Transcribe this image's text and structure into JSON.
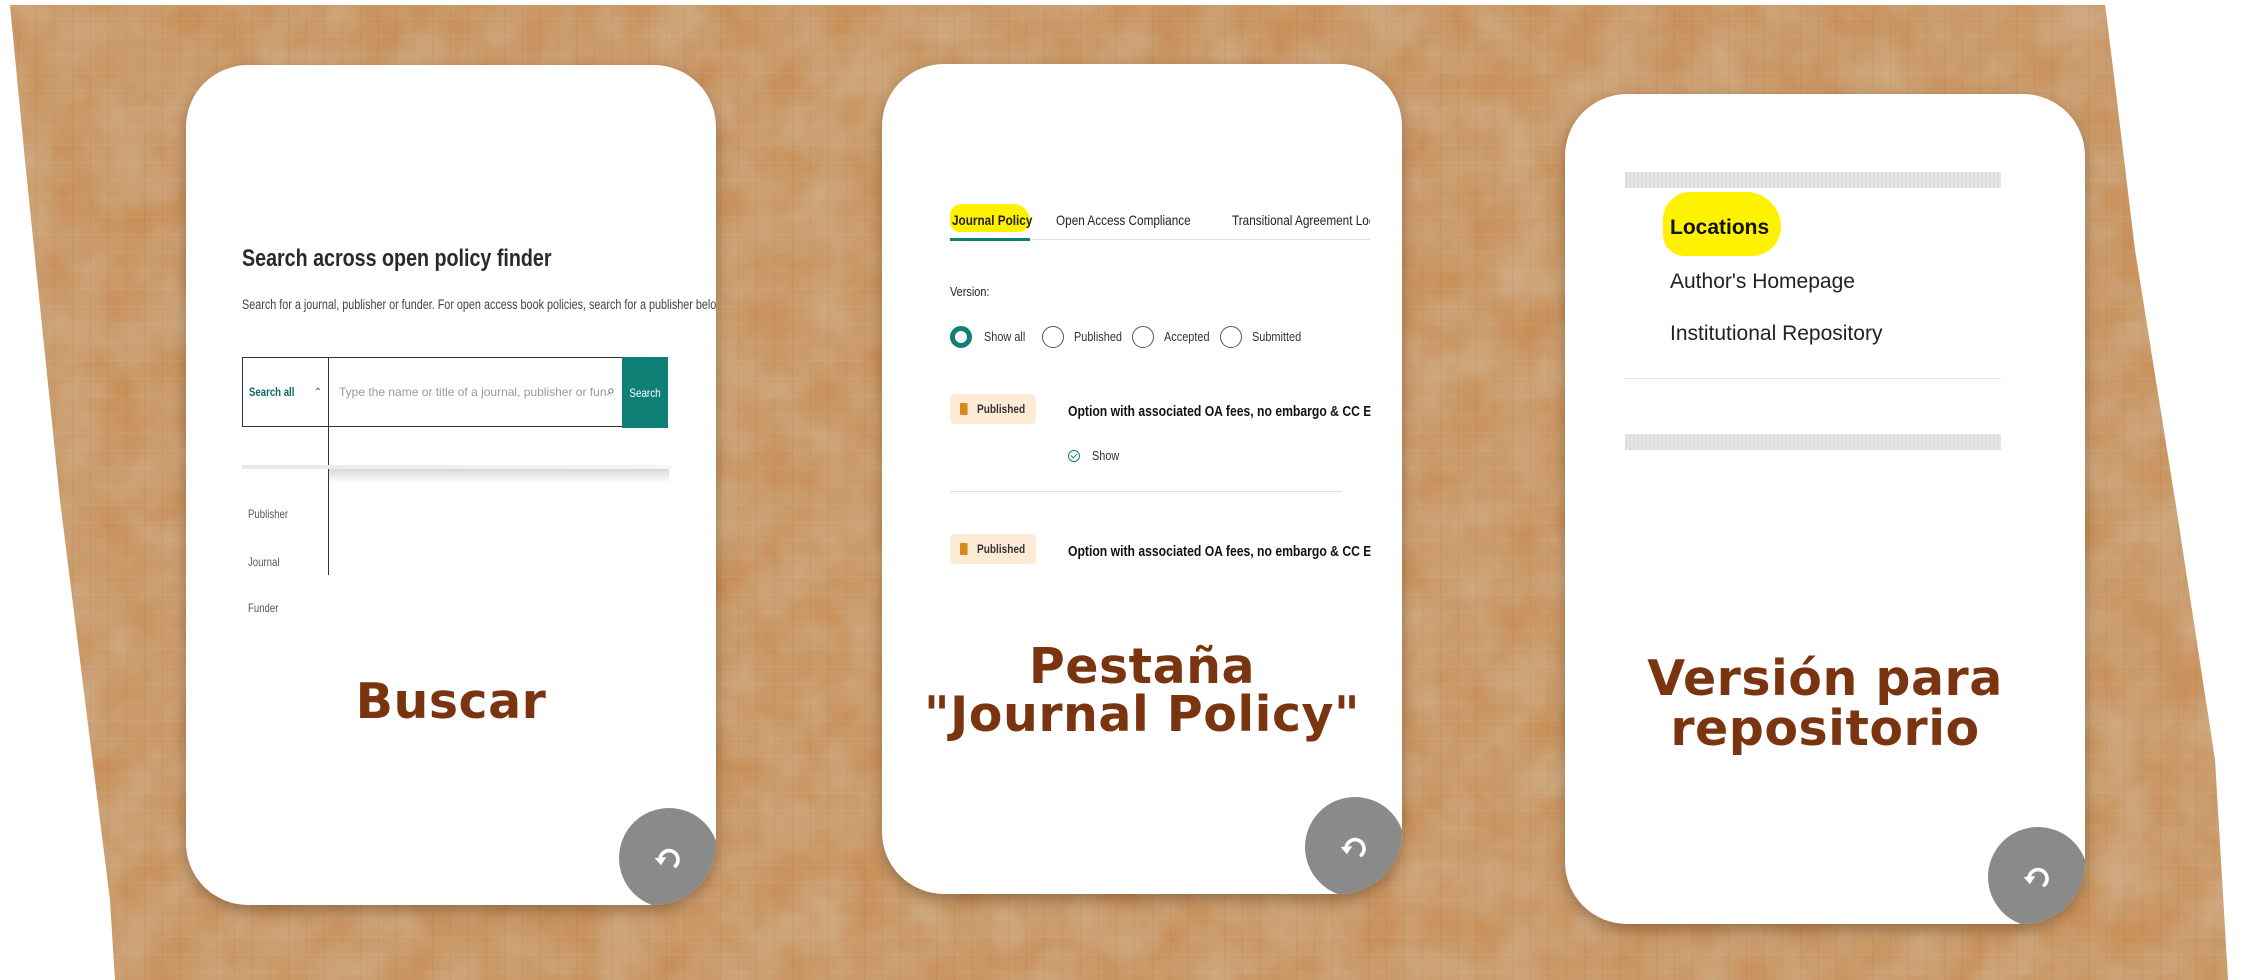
{
  "colors": {
    "card_title": "#7a3510",
    "highlight": "#fff200",
    "accent_teal": "#0e8075",
    "flip_button": "#8a8a8a"
  },
  "cards": [
    {
      "title": "Buscar",
      "flip_icon": "flip-arrow-icon",
      "content": {
        "heading": "Search across open policy finder",
        "description": "Search for a journal, publisher or funder. For open access book policies, search for a publisher below.",
        "scope_selected": "Search all",
        "search_placeholder": "Type the name or title of a journal, publisher or funder...",
        "search_button": "Search",
        "scope_options": [
          "Publisher",
          "Journal",
          "Funder"
        ]
      }
    },
    {
      "title_line1": "Pestaña",
      "title_line2": "\"Journal Policy\"",
      "flip_icon": "flip-arrow-icon",
      "content": {
        "tabs": [
          "Journal Policy",
          "Open Access Compliance",
          "Transitional Agreement Look"
        ],
        "version_label": "Version:",
        "version_options": [
          "Show all",
          "Published",
          "Accepted",
          "Submitted"
        ],
        "version_selected": "Show all",
        "entries": [
          {
            "badge": "Published",
            "text": "Option with associated OA fees, no embargo & CC E",
            "show_label": "Show"
          },
          {
            "badge": "Published",
            "text": "Option with associated OA fees, no embargo & CC E"
          }
        ]
      }
    },
    {
      "title_line1": "Versión para",
      "title_line2": "repositorio",
      "flip_icon": "flip-arrow-icon",
      "content": {
        "heading": "Locations",
        "items": [
          "Author's Homepage",
          "Institutional Repository"
        ]
      }
    }
  ]
}
